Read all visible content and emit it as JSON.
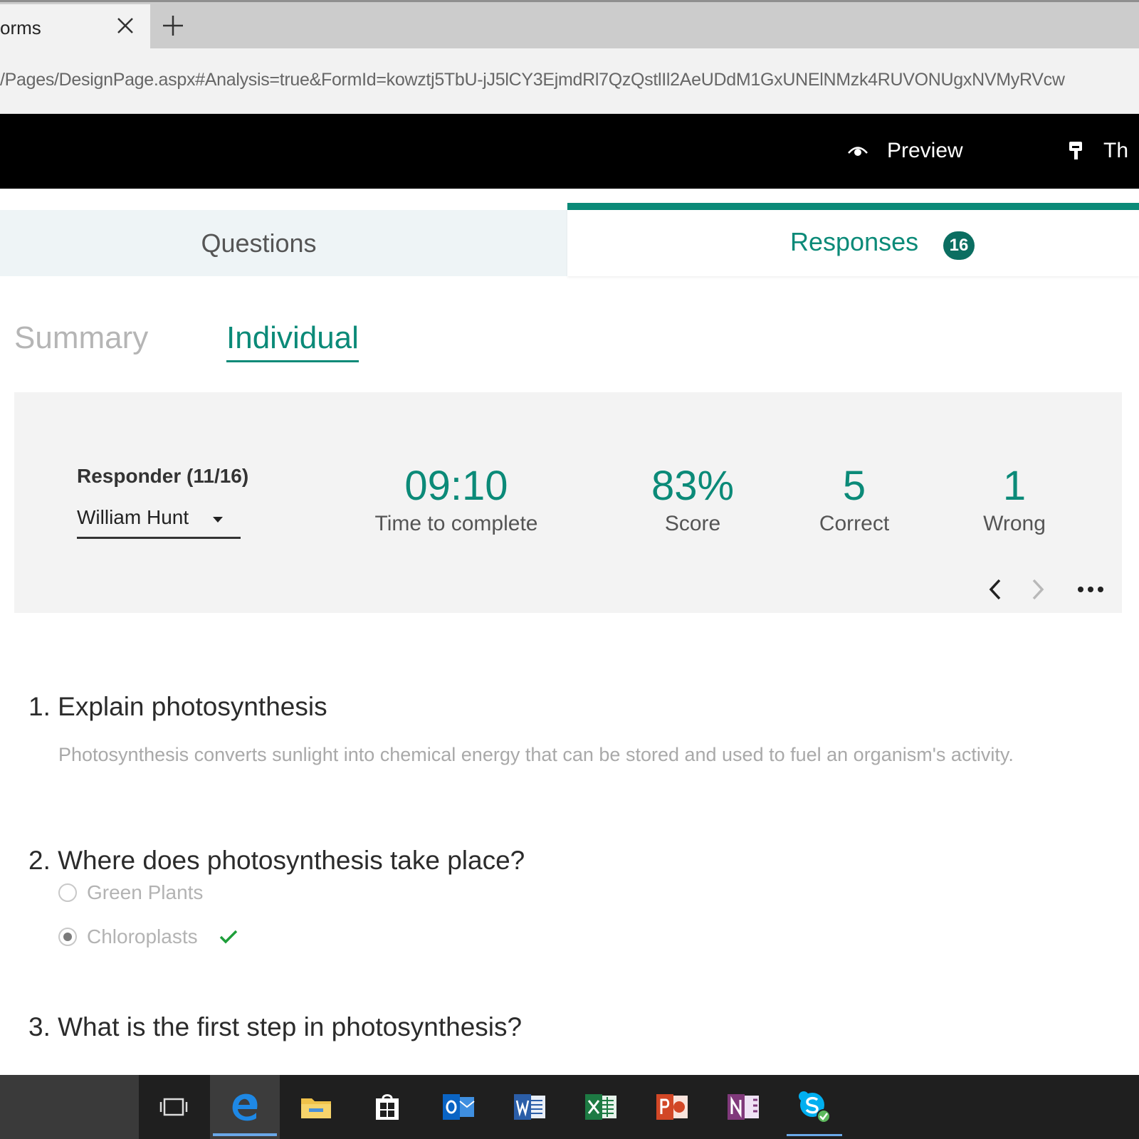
{
  "browser": {
    "tab_title": "orms",
    "url": "/Pages/DesignPage.aspx#Analysis=true&FormId=kowztj5TbU-jJ5lCY3EjmdRl7QzQstlIl2AeUDdM1GxUNElNMzk4RUVONUgxNVMyRVcw"
  },
  "appbar": {
    "preview_label": "Preview",
    "theme_label": "Th",
    "preview_icon": "eye-icon",
    "theme_icon": "paint-brush-icon"
  },
  "tabs": {
    "questions_label": "Questions",
    "responses_label": "Responses",
    "responses_count": "16"
  },
  "subtabs": {
    "summary_label": "Summary",
    "individual_label": "Individual"
  },
  "responder": {
    "heading": "Responder (11/16)",
    "selected_name": "William Hunt"
  },
  "stats": {
    "time_value": "09:10",
    "time_label": "Time to complete",
    "score_value": "83%",
    "score_label": "Score",
    "correct_value": "5",
    "correct_label": "Correct",
    "wrong_value": "1",
    "wrong_label": "Wrong"
  },
  "questions": [
    {
      "title": "1. Explain photosynthesis",
      "answer": "Photosynthesis converts sunlight into chemical energy that can be stored and used to fuel an organism's activity."
    },
    {
      "title": "2. Where does photosynthesis take place?",
      "options": [
        "Green Plants",
        "Chloroplasts"
      ],
      "selected": "Chloroplasts"
    },
    {
      "title": "3. What is the first step in photosynthesis?"
    }
  ],
  "taskbar": {
    "items": [
      "task-view-icon",
      "edge-icon",
      "file-explorer-icon",
      "store-icon",
      "outlook-icon",
      "word-icon",
      "excel-icon",
      "powerpoint-icon",
      "onenote-icon",
      "skype-icon"
    ]
  },
  "colors": {
    "accent": "#0b8a78",
    "badge": "#0b6e61",
    "appbar": "#000000",
    "panel": "#f3f3f3"
  }
}
